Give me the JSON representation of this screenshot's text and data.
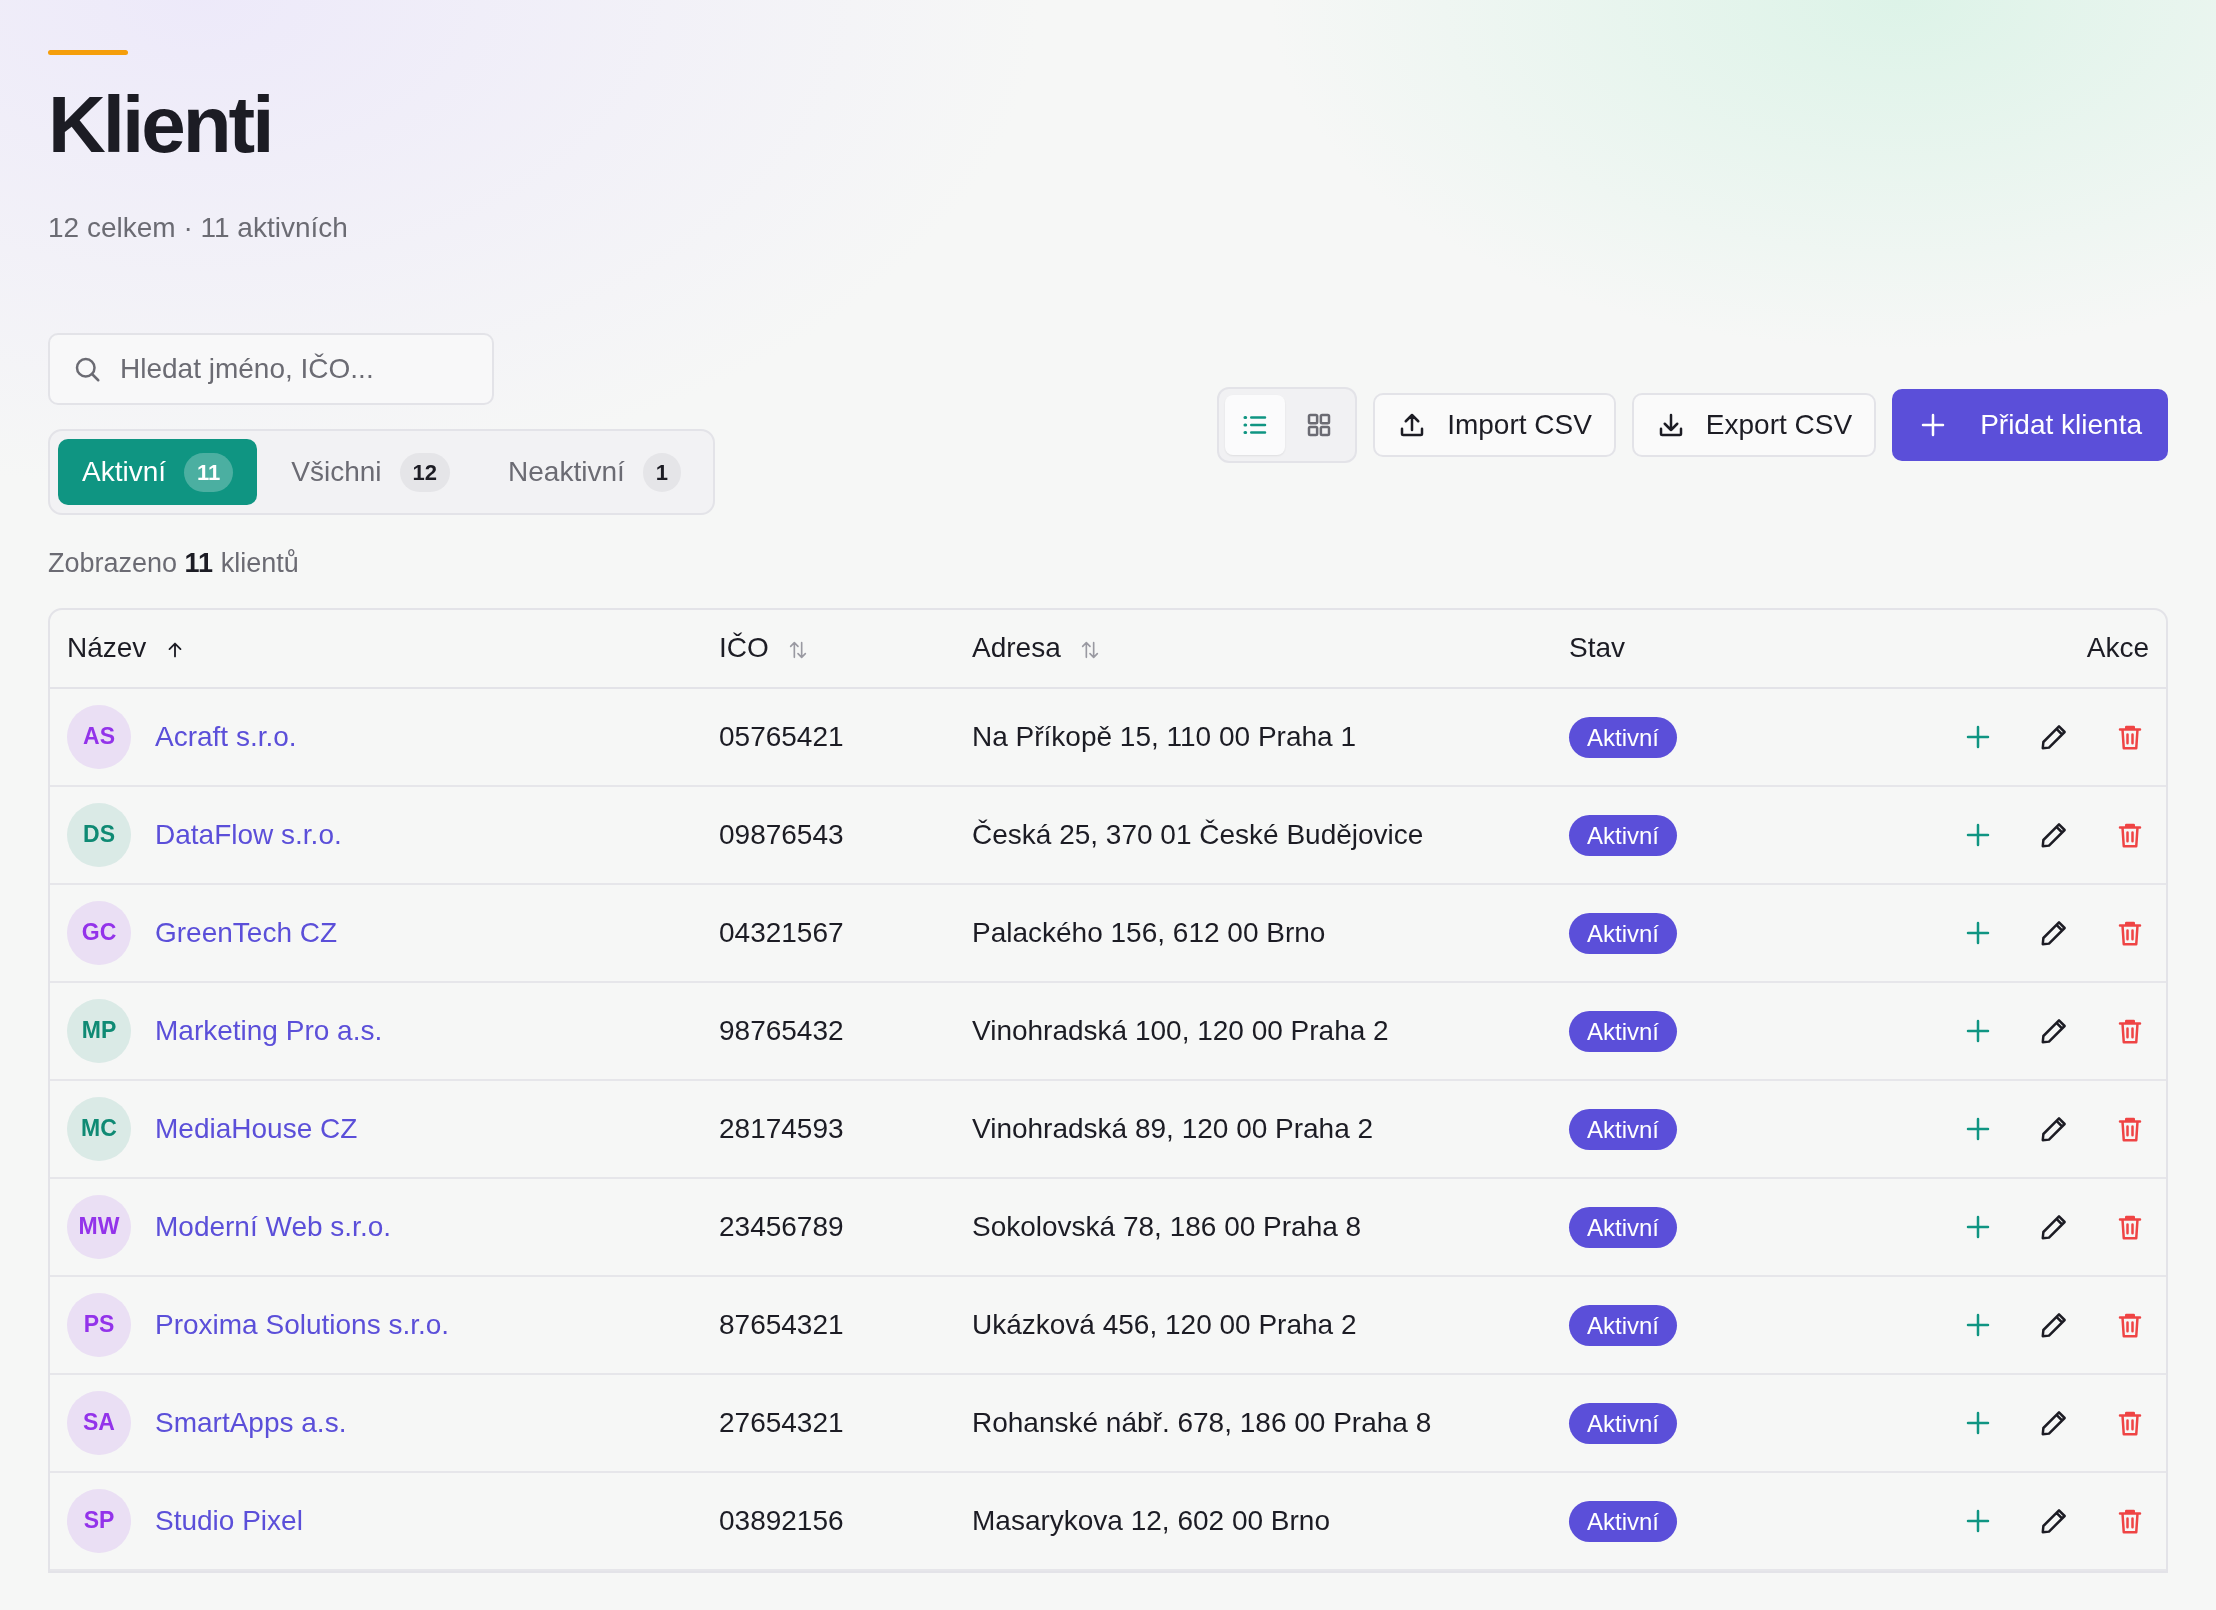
{
  "page": {
    "title": "Klienti",
    "subtitle": "12 celkem · 11 aktivních"
  },
  "search": {
    "placeholder": "Hledat jméno, IČO..."
  },
  "tabs": [
    {
      "label": "Aktivní",
      "count": "11",
      "selected": true
    },
    {
      "label": "Všichni",
      "count": "12",
      "selected": false
    },
    {
      "label": "Neaktivní",
      "count": "1",
      "selected": false
    }
  ],
  "view_toggle": [
    {
      "kind": "list",
      "selected": true
    },
    {
      "kind": "grid",
      "selected": false
    }
  ],
  "buttons": [
    {
      "kind": "import",
      "label": "Import CSV"
    },
    {
      "kind": "export",
      "label": "Export CSV"
    },
    {
      "kind": "add",
      "label": "Přidat klienta"
    }
  ],
  "summary": "Zobrazeno **11** klientů",
  "table": {
    "columns": [
      {
        "label": "Název",
        "sortable": true,
        "sorted": true
      },
      {
        "label": "IČO",
        "sortable": true,
        "sorted": false
      },
      {
        "label": "Adresa",
        "sortable": true,
        "sorted": false
      },
      {
        "label": "Stav",
        "sortable": false,
        "sorted": false
      },
      {
        "label": "Akce",
        "sortable": false,
        "sorted": false
      }
    ],
    "rows": [
      {
        "initials": "AS",
        "color": "#9333ea",
        "name": "Acraft s.r.o.",
        "ico": "05765421",
        "address": "Na Příkopě 15, 110 00 Praha 1",
        "status": "Aktivní"
      },
      {
        "initials": "DS",
        "color": "#0f8a74",
        "name": "DataFlow s.r.o.",
        "ico": "09876543",
        "address": "Česká 25, 370 01 České Budějovice",
        "status": "Aktivní"
      },
      {
        "initials": "GC",
        "color": "#9333ea",
        "name": "GreenTech CZ",
        "ico": "04321567",
        "address": "Palackého 156, 612 00 Brno",
        "status": "Aktivní"
      },
      {
        "initials": "MP",
        "color": "#0f8a74",
        "name": "Marketing Pro a.s.",
        "ico": "98765432",
        "address": "Vinohradská 100, 120 00 Praha 2",
        "status": "Aktivní"
      },
      {
        "initials": "MC",
        "color": "#0f8a74",
        "name": "MediaHouse CZ",
        "ico": "28174593",
        "address": "Vinohradská 89, 120 00 Praha 2",
        "status": "Aktivní"
      },
      {
        "initials": "MW",
        "color": "#9333ea",
        "name": "Moderní Web s.r.o.",
        "ico": "23456789",
        "address": "Sokolovská 78, 186 00 Praha 8",
        "status": "Aktivní"
      },
      {
        "initials": "PS",
        "color": "#9333ea",
        "name": "Proxima Solutions s.r.o.",
        "ico": "87654321",
        "address": "Ukázková 456, 120 00 Praha 2",
        "status": "Aktivní"
      },
      {
        "initials": "SA",
        "color": "#9333ea",
        "name": "SmartApps a.s.",
        "ico": "27654321",
        "address": "Rohanské nábř. 678, 186 00 Praha 8",
        "status": "Aktivní"
      },
      {
        "initials": "SP",
        "color": "#9333ea",
        "name": "Studio Pixel",
        "ico": "03892156",
        "address": "Masarykova 12, 602 00 Brno",
        "status": "Aktivní"
      }
    ]
  }
}
